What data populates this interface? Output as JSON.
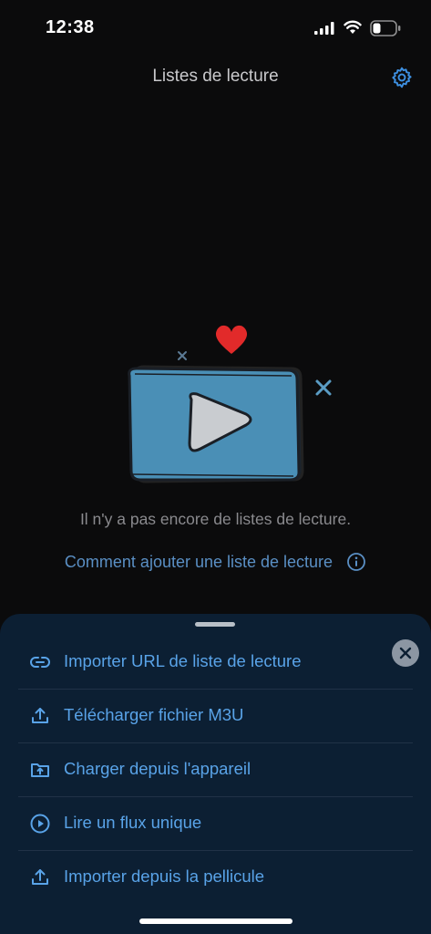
{
  "status_bar": {
    "time": "12:38"
  },
  "nav": {
    "title": "Listes de lecture",
    "settings_icon": "gear-icon"
  },
  "empty_state": {
    "message": "Il n'y a pas encore de listes de lecture.",
    "howto_link": "Comment ajouter une liste de lecture",
    "link_icon": "info-icon"
  },
  "sheet": {
    "close_icon": "close-icon",
    "items": [
      {
        "label": "Importer URL de liste de lecture",
        "icon": "link-icon"
      },
      {
        "label": "Télécharger fichier M3U",
        "icon": "upload-icon"
      },
      {
        "label": "Charger depuis l'appareil",
        "icon": "folder-upload-icon"
      },
      {
        "label": "Lire un flux unique",
        "icon": "play-circle-icon"
      },
      {
        "label": "Importer depuis la pellicule",
        "icon": "upload-icon"
      }
    ]
  },
  "colors": {
    "accent": "#59a3e8",
    "sheet_bg": "#0c1f33",
    "background": "#0b0b0c"
  }
}
